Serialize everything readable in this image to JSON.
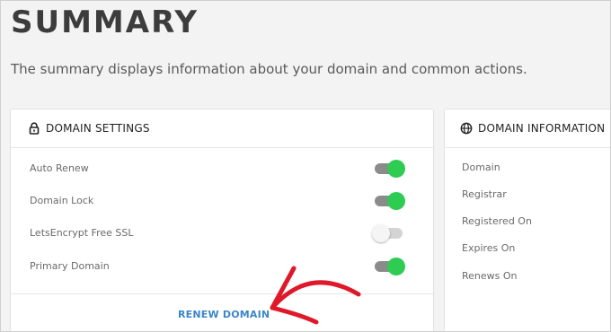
{
  "page": {
    "title": "SUMMARY",
    "subtitle": "The summary displays information about your domain and common actions."
  },
  "settings": {
    "header": "DOMAIN SETTINGS",
    "icon": "lock-icon",
    "rows": [
      {
        "label": "Auto Renew",
        "enabled": true
      },
      {
        "label": "Domain Lock",
        "enabled": true
      },
      {
        "label": "LetsEncrypt Free SSL",
        "enabled": false
      },
      {
        "label": "Primary Domain",
        "enabled": true
      }
    ],
    "renew_label": "RENEW DOMAIN"
  },
  "info": {
    "header": "DOMAIN INFORMATION",
    "icon": "globe-icon",
    "rows": [
      "Domain",
      "Registrar",
      "Registered On",
      "Expires On",
      "Renews On"
    ]
  },
  "colors": {
    "toggle_on": "#2ecc52",
    "link": "#3b86c9",
    "annotation_arrow": "#e0192a"
  }
}
